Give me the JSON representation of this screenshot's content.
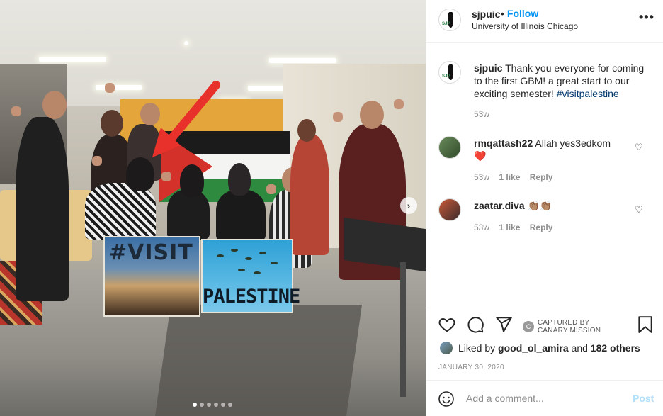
{
  "header": {
    "username": "sjpuic",
    "separator": "•",
    "follow_label": "Follow",
    "location": "University of Illinois Chicago",
    "more_glyph": "•••"
  },
  "caption": {
    "username": "sjpuic",
    "text": "Thank you everyone for coming to the first GBM! a great start to our exciting semester! ",
    "hashtag": "#visitpalestine",
    "age": "53w"
  },
  "comments": [
    {
      "username": "rmqattash22",
      "text": "Allah yes3edkom",
      "emoji": "❤️",
      "age": "53w",
      "likes": "1 like",
      "reply": "Reply"
    },
    {
      "username": "zaatar.diva",
      "text": "",
      "emoji": "👏🏽👏🏽",
      "age": "53w",
      "likes": "1 like",
      "reply": "Reply"
    }
  ],
  "actions": {
    "captured_line1": "CAPTURED BY",
    "captured_line2": "CANARY MISSION"
  },
  "liked_by": {
    "prefix": "Liked by ",
    "user": "good_ol_amira",
    "middle": " and ",
    "others": "182 others"
  },
  "date": "JANUARY 30, 2020",
  "add_comment": {
    "placeholder": "Add a comment...",
    "post_label": "Post"
  },
  "photo": {
    "sign1_text": "#VISIT",
    "sign2_text": "PALESTINE",
    "next_glyph": "›",
    "carousel_count": 6,
    "carousel_active": 0
  },
  "colors": {
    "accent": "#0095f6",
    "post_disabled": "#b2dffc",
    "hashtag": "#00376b",
    "arrow": "#e8312a"
  },
  "icons": [
    "heart-icon",
    "comment-icon",
    "share-icon",
    "bookmark-icon",
    "emoji-icon",
    "more-icon",
    "chevron-right-icon"
  ]
}
